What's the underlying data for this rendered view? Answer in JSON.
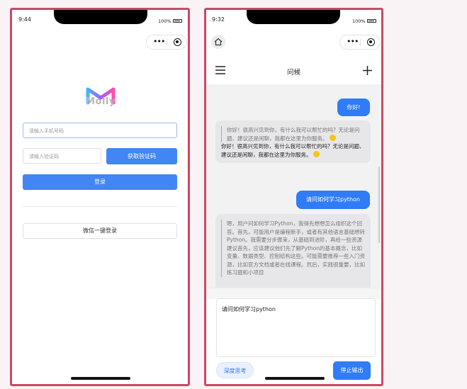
{
  "login": {
    "status_time": "9:44",
    "battery": "100%",
    "logo_text": "Molly",
    "phone_placeholder": "请输入手机号码",
    "code_placeholder": "请输入验证码",
    "get_code_label": "获取验证码",
    "login_label": "登录",
    "wechat_login_label": "微信一键登录"
  },
  "chat": {
    "status_time": "9:32",
    "battery": "100%",
    "title": "问候",
    "messages": [
      {
        "role": "user",
        "text": "你好!"
      },
      {
        "role": "assistant",
        "thinking": "你好！很高兴见到你，有什么我可以帮忙的吗？无论是问题、建议还是闲聊，我都在这里为你服务。",
        "answer": "你好！很高兴见到你，有什么我可以帮忙的吗？无论是问题、建议还是闲聊，我都在这里为你服务。"
      },
      {
        "role": "user",
        "text": "请问如何学习python"
      },
      {
        "role": "assistant",
        "thinking": "嗯，用户问如何学习Python，我得先想想怎么组织这个回答。首先，可能用户是编程新手，或者有其他语言基础想转Python。我需要分步骤来，从基础到进阶，再给一些资源建议首先，应该建议他们先了解Python的基本概念，比如变量、数据类型、控制结构这些。可能需要推荐一些入门资源，比如官方文档或者在线课程。然后，实践很重要，比如练习题和小项目"
      }
    ],
    "input_value": "请问如何学习python",
    "deep_think_label": "深度思考",
    "stop_label": "停止输出"
  },
  "colors": {
    "accent": "#4285f4",
    "chat_accent": "#2f7cf6",
    "frame_border": "#c84a66"
  }
}
